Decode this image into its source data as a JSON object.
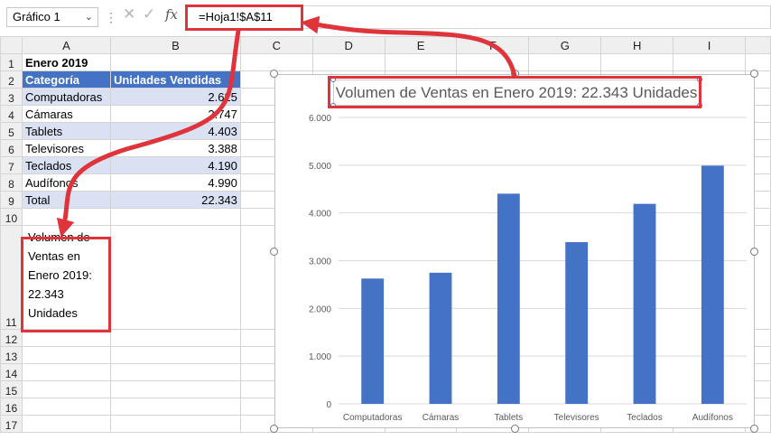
{
  "formula_bar": {
    "name_box": "Gráfico 1",
    "name_box_arrow": "⌄",
    "dots": "⋮",
    "cancel": "✕",
    "enter": "✓",
    "fx": "fx",
    "formula": "=Hoja1!$A$11"
  },
  "columns": [
    "A",
    "B",
    "C",
    "D",
    "E",
    "F",
    "G",
    "H",
    "I"
  ],
  "rows": [
    "1",
    "2",
    "3",
    "4",
    "5",
    "6",
    "7",
    "8",
    "9",
    "10",
    "11",
    "12",
    "13",
    "14",
    "15",
    "16",
    "17"
  ],
  "sheet": {
    "title": "Enero 2019",
    "headers": [
      "Categoría",
      "Unidades Vendidas"
    ],
    "data": [
      {
        "cat": "Computadoras",
        "val": "2.625"
      },
      {
        "cat": "Cámaras",
        "val": "2.747"
      },
      {
        "cat": "Tablets",
        "val": "4.403"
      },
      {
        "cat": "Televisores",
        "val": "3.388"
      },
      {
        "cat": "Teclados",
        "val": "4.190"
      },
      {
        "cat": "Audífonos",
        "val": "4.990"
      }
    ],
    "total_label": "Total",
    "total_value": "22.343",
    "a11_text": "Volumen de Ventas en Enero 2019: 22.343 Unidades"
  },
  "colors": {
    "bar": "#4472c4",
    "header_fill": "#4472c4",
    "band_fill": "#d9e1f2",
    "highlight": "#e0343c"
  },
  "chart_data": {
    "type": "bar",
    "title": "Volumen de Ventas en Enero 2019: 22.343 Unidades",
    "categories": [
      "Computadoras",
      "Cámaras",
      "Tablets",
      "Televisores",
      "Teclados",
      "Audífonos"
    ],
    "values": [
      2625,
      2747,
      4403,
      3388,
      4190,
      4990
    ],
    "ylim": [
      0,
      6000
    ],
    "yticks": [
      0,
      1000,
      2000,
      3000,
      4000,
      5000,
      6000
    ],
    "ytick_labels": [
      "0",
      "1.000",
      "2.000",
      "3.000",
      "4.000",
      "5.000",
      "6.000"
    ],
    "grid": true,
    "legend": "none"
  }
}
